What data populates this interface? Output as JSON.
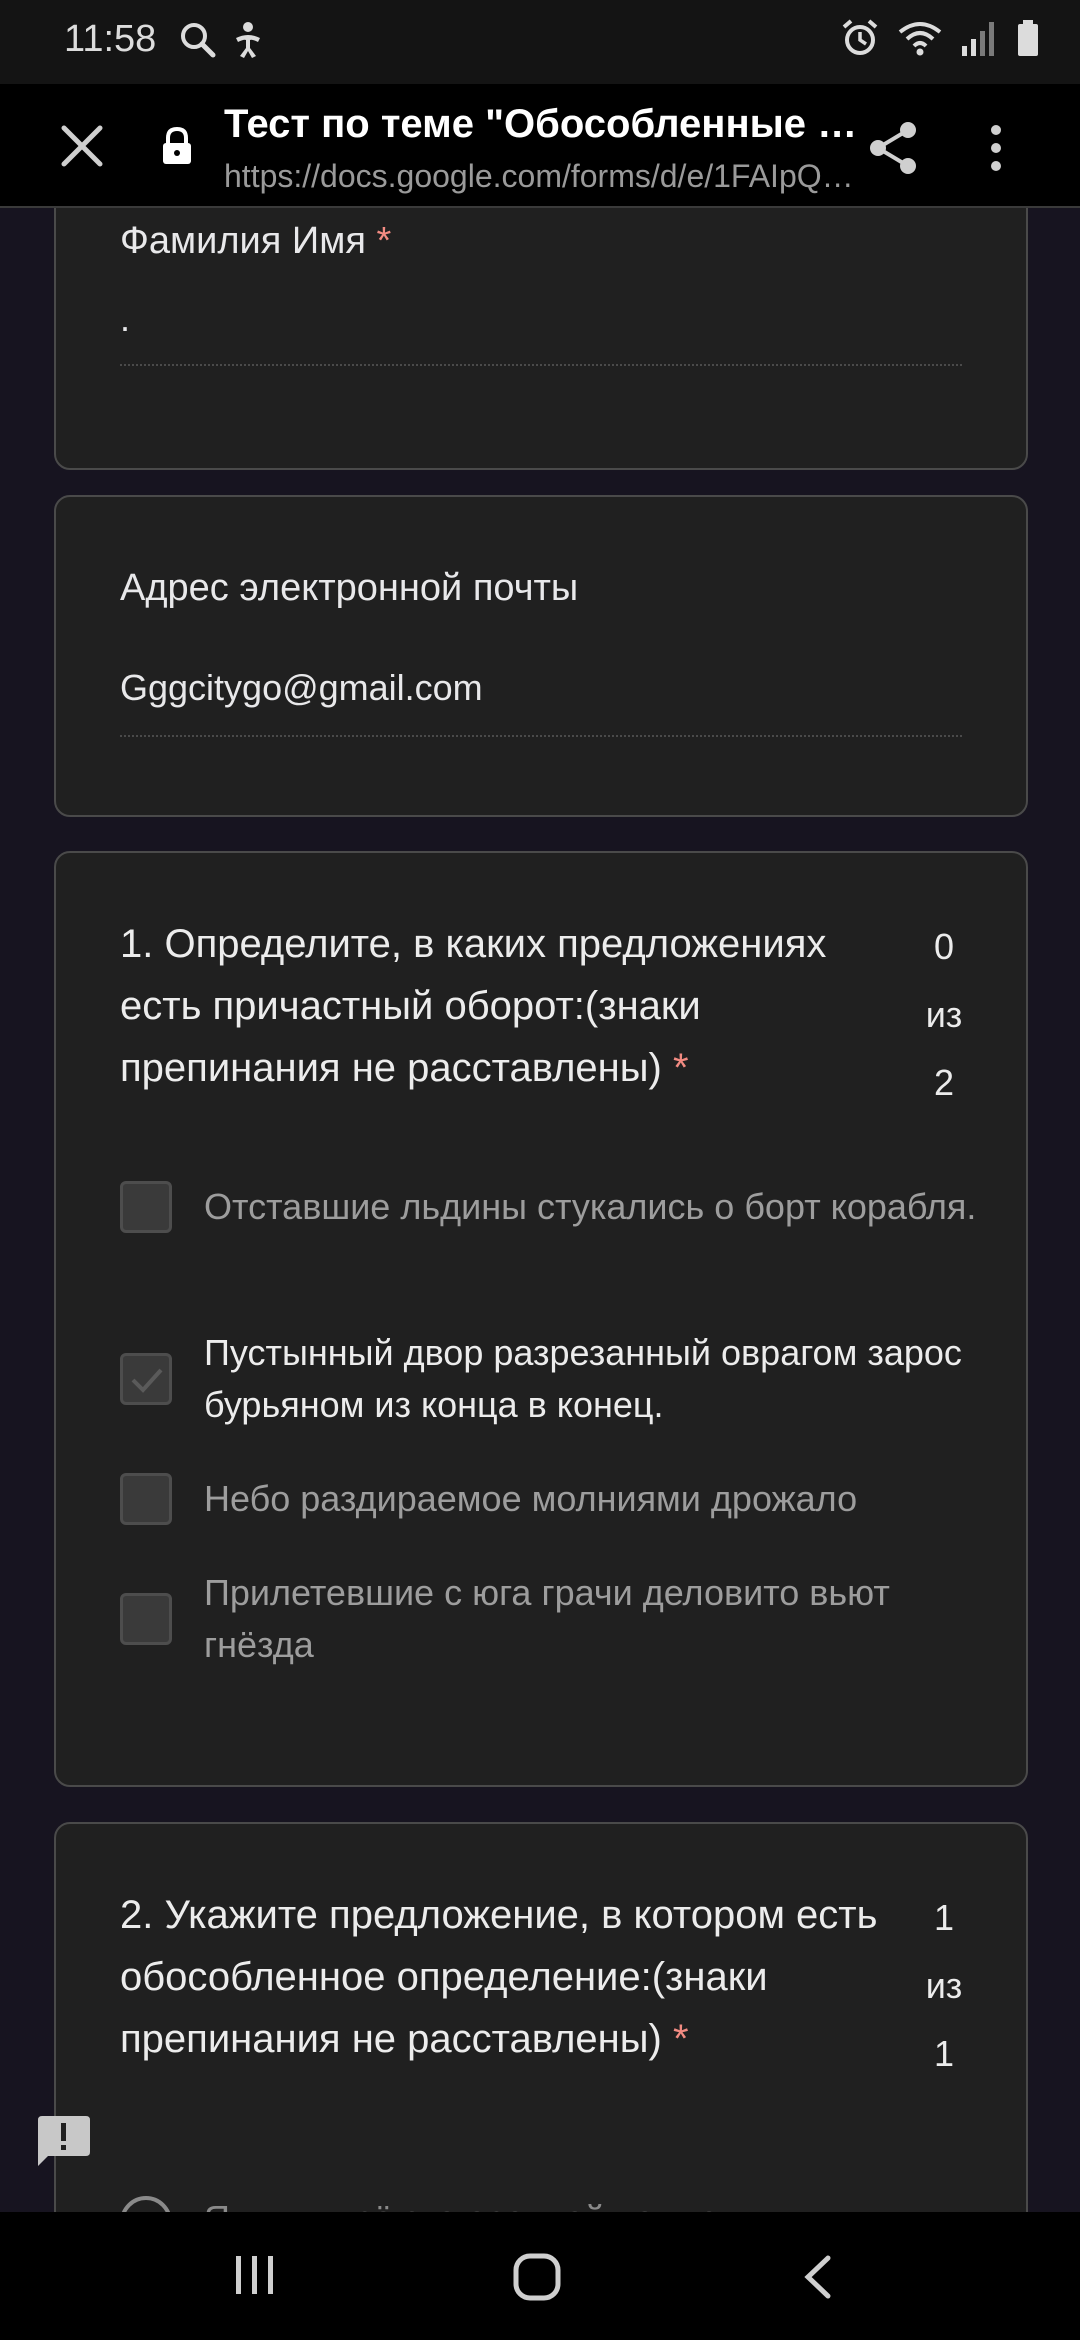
{
  "status_bar": {
    "time": "11:58",
    "icons": [
      "search-icon",
      "accessibility-icon",
      "alarm-icon",
      "wifi-icon",
      "signal-icon",
      "battery-icon"
    ]
  },
  "toolbar": {
    "title": "Тест по теме \"Обособленные чл…",
    "url": "https://docs.google.com/forms/d/e/1FAIpQL…",
    "icons": [
      "close-icon",
      "lock-icon",
      "share-icon",
      "more-vert-icon"
    ]
  },
  "form": {
    "name_field": {
      "label": "Фамилия Имя",
      "required_mark": "*",
      "value": "."
    },
    "email_field": {
      "label": "Адрес электронной почты",
      "value": "Gggcitygo@gmail.com"
    },
    "question1": {
      "text": "1. Определите, в каких предложениях есть причастный оборот:(знаки препинания не расставлены)",
      "required_mark": "*",
      "score": [
        "0",
        "из",
        "2"
      ],
      "options": [
        {
          "label": "Отставшие льдины стукались о борт корабля.",
          "checked": false
        },
        {
          "label": "Пустынный двор разрезанный оврагом зарос бурьяном из конца в конец.",
          "checked": true
        },
        {
          "label": "Небо раздираемое молниями дрожало",
          "checked": false
        },
        {
          "label": "Прилетевшие с юга грачи деловито вьют гнёзда",
          "checked": false
        }
      ]
    },
    "question2": {
      "text": "2. Укажите предложение, в котором есть обособленное определение:(знаки препинания не расставлены)",
      "required_mark": "*",
      "score": [
        "1",
        "из",
        "1"
      ],
      "partial_option": "Я пишу всё это осенней ночью"
    }
  },
  "feedback_icon": "feedback-icon",
  "nav_bar": {
    "icons": [
      "recent-apps-icon",
      "home-icon",
      "back-icon"
    ]
  },
  "colors": {
    "background": "#171420",
    "card": "#202020",
    "card_border": "#4a4a4a",
    "required": "#f28b82",
    "toolbar": "#000000"
  }
}
